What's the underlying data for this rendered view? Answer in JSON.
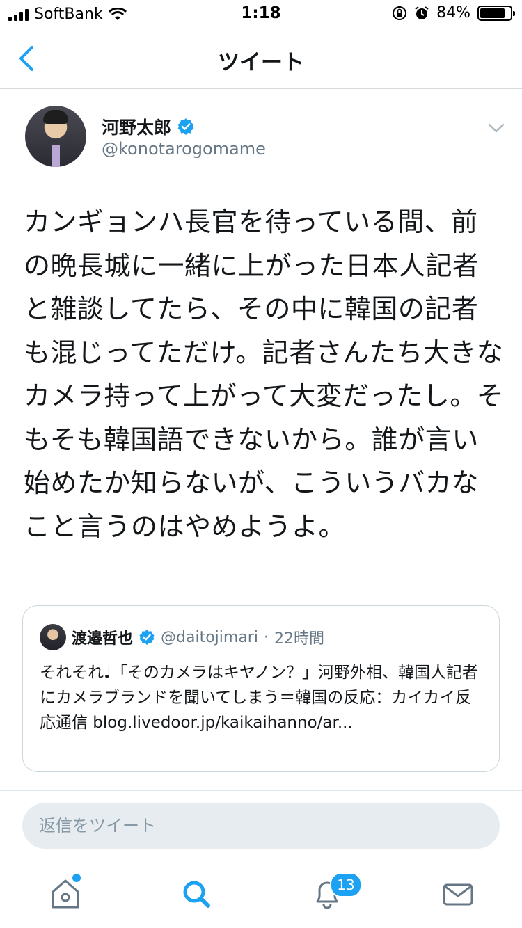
{
  "status_bar": {
    "carrier": "SoftBank",
    "time": "1:18",
    "battery": "84%",
    "battery_level": 0.84
  },
  "nav": {
    "title": "ツイート",
    "back_icon": "chevron-left-icon"
  },
  "tweet": {
    "author_name": "河野太郎",
    "author_handle": "@konotarogomame",
    "text": "カンギョンハ長官を待っている間、前の晩長城に一緒に上がった日本人記者と雑談してたら、その中に韓国の記者も混じってただけ。記者さんたち大きなカメラ持って上がって大変だったし。そもそも韓国語できないから。誰が言い始めたか知らないが、こういうバカなこと言うのはやめようよ。"
  },
  "quote": {
    "author_name": "渡邉哲也",
    "author_handle": "@daitojimari",
    "separator": "·",
    "time": "22時間",
    "text": "それそれ♩「そのカメラはキヤノン？」河野外相、韓国人記者にカメラブランドを聞いてしまう＝韓国の反応：カイカイ反応通信 blog.livedoor.jp/kaikaihanno/ar..."
  },
  "reply": {
    "placeholder": "返信をツイート"
  },
  "tab_bar": {
    "tabs": [
      "home-icon",
      "search-icon",
      "notifications-icon",
      "messages-icon"
    ],
    "notifications_badge": "13"
  },
  "colors": {
    "accent": "#1da1f2",
    "secondary_text": "#657786"
  }
}
